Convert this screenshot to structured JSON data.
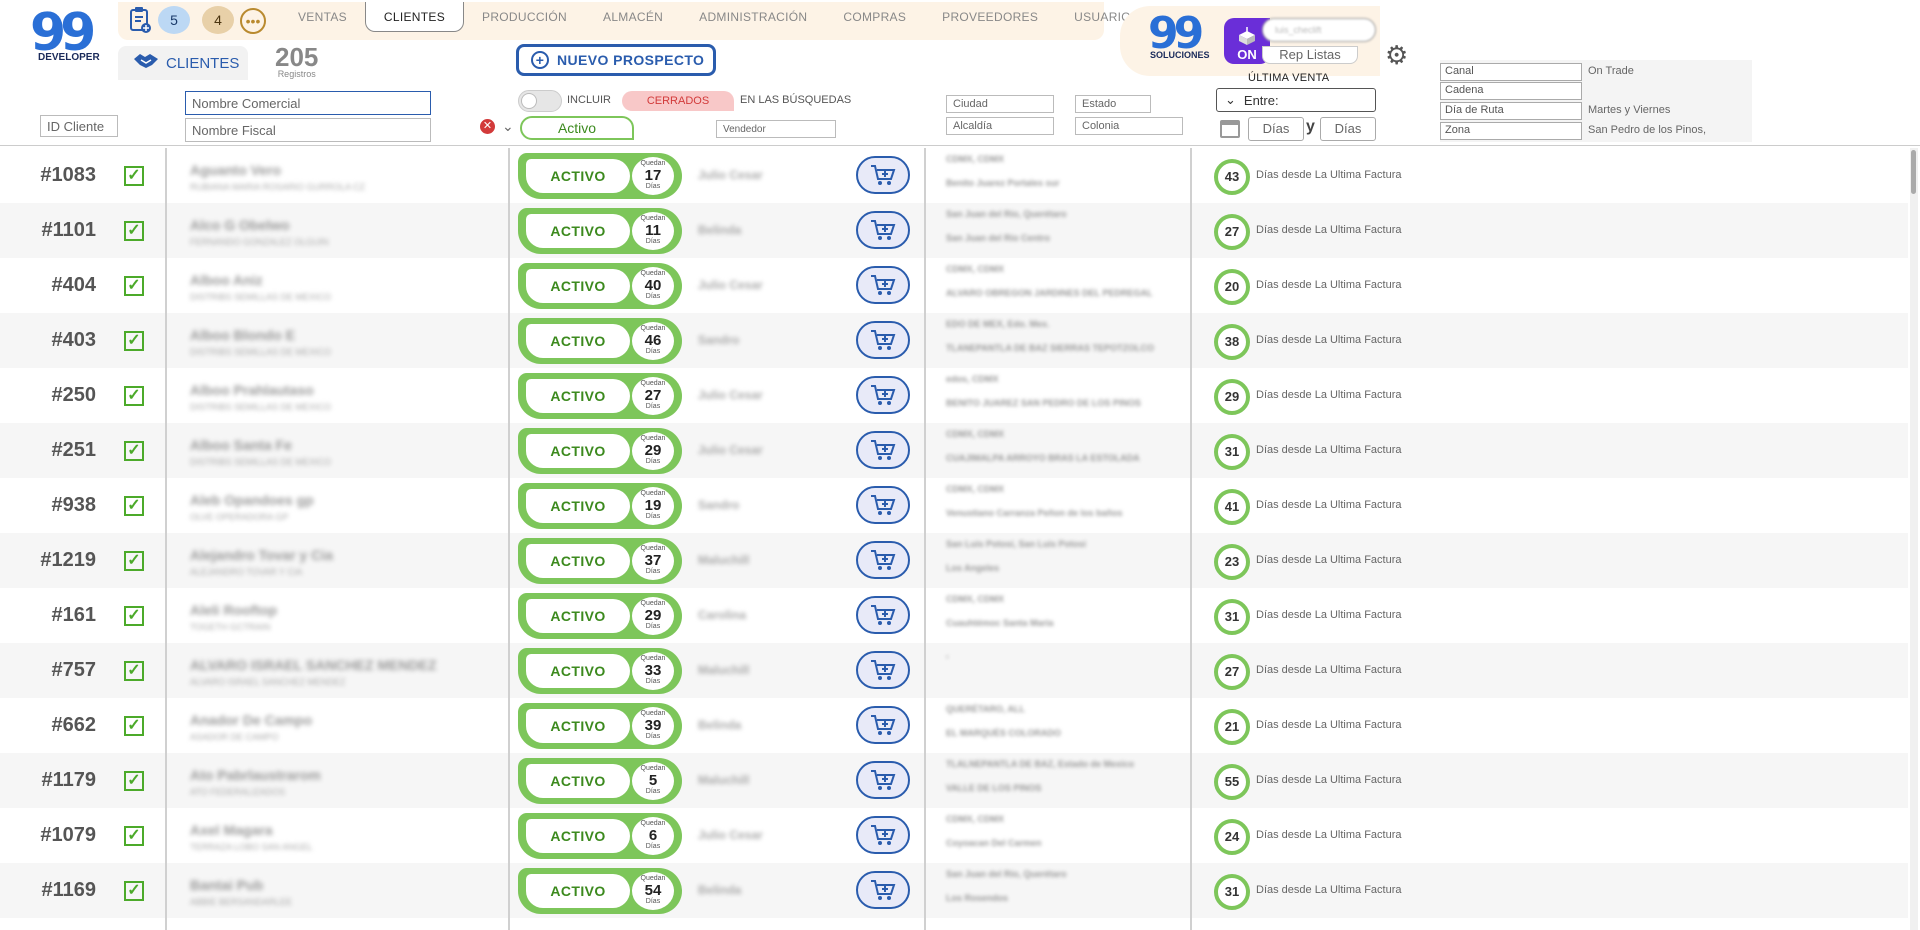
{
  "header": {
    "logo_left_text": "99",
    "logo_left_sub": "DEVELOPER",
    "badge_blue": "5",
    "badge_tan": "4",
    "dots": "•••",
    "tabs": [
      "VENTAS",
      "CLIENTES",
      "PRODUCCIÓN",
      "ALMACÉN",
      "ADMINISTRACIÓN",
      "COMPRAS",
      "PROVEEDORES",
      "USUARIOS"
    ],
    "active_tab": "CLIENTES",
    "clients_label": "CLIENTES",
    "record_count": "205",
    "record_label": "Registros",
    "new_button": "NUEVO PROSPECTO",
    "logo_right_text": "99",
    "logo_right_sub": "SOLUCIONES",
    "on_label": "ON",
    "user_placeholder": "luis_checlift",
    "rep_listas": "Rep Listas"
  },
  "filters": {
    "id_cliente": "ID Cliente",
    "nombre_comercial": "Nombre Comercial",
    "nombre_fiscal": "Nombre Fiscal",
    "incluir": "INCLUIR",
    "cerrados": "CERRADOS",
    "en_busquedas": "EN LAS BÚSQUEDAS",
    "status_selected": "Activo",
    "vendedor": "Vendedor",
    "ciudad": "Ciudad",
    "estado": "Estado",
    "alcaldia": "Alcaldía",
    "colonia": "Colonia",
    "ultima_venta": "ÚLTIMA VENTA",
    "entre": "Entre:",
    "dias_1": "Días",
    "y": "y",
    "dias_2": "Días",
    "side": [
      {
        "label": "Canal",
        "value": "On Trade"
      },
      {
        "label": "Cadena",
        "value": ""
      },
      {
        "label": "Día de Ruta",
        "value": "Martes y Viernes"
      },
      {
        "label": "Zona",
        "value": "San Pedro de los Pinos,"
      }
    ]
  },
  "rows": [
    {
      "id": "#1083",
      "name": "Aguanto Vero",
      "fiscal": "RUBIANA MARIA ROSARIO GURROLA CZ",
      "status": "ACTIVO",
      "quedan": "Quedan",
      "days_left": "17",
      "dias": "Días",
      "vendor": "Julio Cesar",
      "addr1": "CDMX, CDMX",
      "addr2": "Benito Juarez Portales sur",
      "since": "43",
      "since_text": "Días desde La Ultima Factura"
    },
    {
      "id": "#1101",
      "name": "Alco G Obelwo",
      "fiscal": "FERNANDO GONZALEZ OLGUIN",
      "status": "ACTIVO",
      "quedan": "Quedan",
      "days_left": "11",
      "dias": "Días",
      "vendor": "Belinda",
      "addr1": "San Juan del Río, Querétaro",
      "addr2": "San Juan del Río Centro",
      "since": "27",
      "since_text": "Días desde La Ultima Factura"
    },
    {
      "id": "#404",
      "name": "Alboo Aniz",
      "fiscal": "DISTRIBS SEMILLAS DE MEXICO",
      "status": "ACTIVO",
      "quedan": "Quedan",
      "days_left": "40",
      "dias": "Días",
      "vendor": "Julio Cesar",
      "addr1": "CDMX, CDMX",
      "addr2": "ALVARO OBREGON JARDINES DEL PEDREGAL",
      "since": "20",
      "since_text": "Días desde La Ultima Factura"
    },
    {
      "id": "#403",
      "name": "Alboo Blondo E",
      "fiscal": "DISTRIBS SEMILLAS DE MEXICO",
      "status": "ACTIVO",
      "quedan": "Quedan",
      "days_left": "46",
      "dias": "Días",
      "vendor": "Sandro",
      "addr1": "EDO DE MEX, Edo. Mex.",
      "addr2": "TLANEPANTLA DE BAZ SIERRAS TEPOTZOLCO",
      "since": "38",
      "since_text": "Días desde La Ultima Factura"
    },
    {
      "id": "#250",
      "name": "Alboo Prahlautaso",
      "fiscal": "DISTRIBS SEMILLAS DE MEXICO",
      "status": "ACTIVO",
      "quedan": "Quedan",
      "days_left": "27",
      "dias": "Días",
      "vendor": "Julio Cesar",
      "addr1": "edos, CDMX",
      "addr2": "BENITO JUAREZ SAN PEDRO DE LOS PINOS",
      "since": "29",
      "since_text": "Días desde La Ultima Factura"
    },
    {
      "id": "#251",
      "name": "Alboo Santa Fe",
      "fiscal": "DISTRIBS SEMILLAS DE MEXICO",
      "status": "ACTIVO",
      "quedan": "Quedan",
      "days_left": "29",
      "dias": "Días",
      "vendor": "Julio Cesar",
      "addr1": "CDMX, CDMX",
      "addr2": "CUAJIMALPA ARROYO BRAS LA ESTOLADA",
      "since": "31",
      "since_text": "Días desde La Ultima Factura"
    },
    {
      "id": "#938",
      "name": "Aleb Opandoes gp",
      "fiscal": "OLVE OPERADORA GP",
      "status": "ACTIVO",
      "quedan": "Quedan",
      "days_left": "19",
      "dias": "Días",
      "vendor": "Sandro",
      "addr1": "CDMX, CDMX",
      "addr2": "Venustiano Carranza Peñon de los baños",
      "since": "41",
      "since_text": "Días desde La Ultima Factura"
    },
    {
      "id": "#1219",
      "name": "Alejandro Tovar y Cia",
      "fiscal": "ALEJANDRO TOVAR Y CIA",
      "status": "ACTIVO",
      "quedan": "Quedan",
      "days_left": "37",
      "dias": "Días",
      "vendor": "Maluchill",
      "addr1": "San Luis Potosí, San Luis Potosí",
      "addr2": "Los Angeles",
      "since": "23",
      "since_text": "Días desde La Ultima Factura"
    },
    {
      "id": "#161",
      "name": "Aleli Rooftop",
      "fiscal": "TOGETH GCTRAIN",
      "status": "ACTIVO",
      "quedan": "Quedan",
      "days_left": "29",
      "dias": "Días",
      "vendor": "Carolina",
      "addr1": "CDMX, CDMX",
      "addr2": "Cuauhtémoc Santa Maria",
      "since": "31",
      "since_text": "Días desde La Ultima Factura"
    },
    {
      "id": "#757",
      "name": "ALVARO ISRAEL SANCHEZ MENDEZ",
      "fiscal": "ALVARO ISRAEL SANCHEZ MENDEZ",
      "status": "ACTIVO",
      "quedan": "Quedan",
      "days_left": "33",
      "dias": "Días",
      "vendor": "Maluchill",
      "addr1": ",",
      "addr2": "",
      "since": "27",
      "since_text": "Días desde La Ultima Factura"
    },
    {
      "id": "#662",
      "name": "Anador De Campo",
      "fiscal": "ASADOR DE CAMPO",
      "status": "ACTIVO",
      "quedan": "Quedan",
      "days_left": "39",
      "dias": "Días",
      "vendor": "Belinda",
      "addr1": "QUERÉTARO, ALL",
      "addr2": "EL MARQUÉS COLORADO",
      "since": "21",
      "since_text": "Días desde La Ultima Factura"
    },
    {
      "id": "#1179",
      "name": "Ato Pabrlaustrarom",
      "fiscal": "ATO FEDERALIZADOS",
      "status": "ACTIVO",
      "quedan": "Quedan",
      "days_left": "5",
      "dias": "Días",
      "vendor": "Maluchill",
      "addr1": "TLALNEPANTLA DE BAZ, Estado de Mexico",
      "addr2": "VALLE DE LOS PINOS",
      "since": "55",
      "since_text": "Días desde La Ultima Factura"
    },
    {
      "id": "#1079",
      "name": "Axel Magara",
      "fiscal": "TERRAZA LOBO SAN ANGEL",
      "status": "ACTIVO",
      "quedan": "Quedan",
      "days_left": "6",
      "dias": "Días",
      "vendor": "Julio Cesar",
      "addr1": "CDMX, CDMX",
      "addr2": "Coyoacan Del Carmen",
      "since": "24",
      "since_text": "Días desde La Ultima Factura"
    },
    {
      "id": "#1169",
      "name": "Bantai Pub",
      "fiscal": "ABBIE BERSANDARLEE",
      "status": "ACTIVO",
      "quedan": "Quedan",
      "days_left": "54",
      "dias": "Días",
      "vendor": "Belinda",
      "addr1": "San Juan del Río, Querétaro",
      "addr2": "Los Rosendos",
      "since": "31",
      "since_text": "Días desde La Ultima Factura"
    }
  ],
  "colors": {
    "accent_blue": "#2a5cad",
    "status_green": "#7dc65a",
    "closed_red": "#d23a3a",
    "on_purple": "#6a2ed8"
  }
}
